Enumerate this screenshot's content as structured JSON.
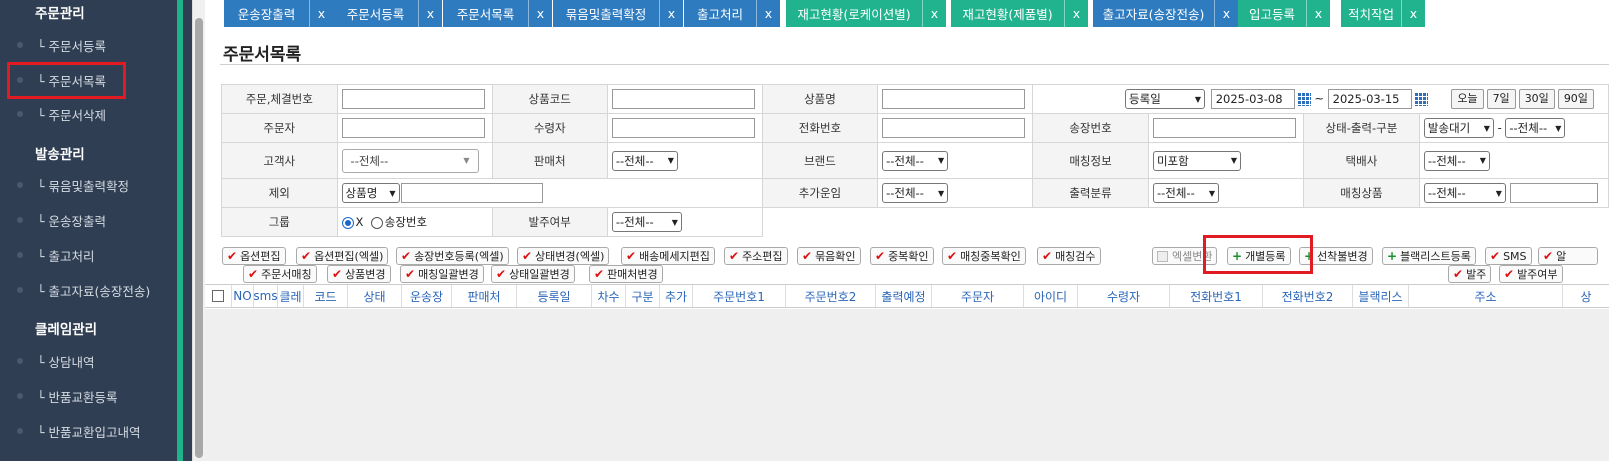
{
  "sidebar": {
    "sections": [
      {
        "title": "주문관리",
        "items": [
          "└ 주문서등록",
          "└ 주문서목록",
          "└ 주문서삭제"
        ]
      },
      {
        "title": "발송관리",
        "items": [
          "└ 묶음및출력확정",
          "└ 운송장출력",
          "└ 출고처리",
          "└ 출고자료(송장전송)"
        ]
      },
      {
        "title": "클레임관리",
        "items": [
          "└ 상담내역",
          "└ 반품교환등록",
          "└ 반품교환입고내역"
        ]
      }
    ]
  },
  "tabs": [
    {
      "label": "운송장출력",
      "close": "x",
      "color": "blue"
    },
    {
      "label": "주문서등록",
      "close": "x",
      "color": "blue"
    },
    {
      "label": "주문서목록",
      "close": "x",
      "color": "blue"
    },
    {
      "label": "묶음및출력확정",
      "close": "x",
      "color": "blue"
    },
    {
      "label": "출고처리",
      "close": "x",
      "color": "blue"
    },
    {
      "label": "재고현황(로케이션별)",
      "close": "x",
      "color": "green"
    },
    {
      "label": "재고현황(제품별)",
      "close": "x",
      "color": "green"
    },
    {
      "label": "출고자료(송장전송)",
      "close": "x",
      "color": "blue"
    },
    {
      "label": "입고등록",
      "close": "x",
      "color": "green"
    },
    {
      "label": "적치작업",
      "close": "x",
      "color": "green"
    }
  ],
  "page": {
    "title": "주문서목록"
  },
  "search": {
    "row1": {
      "order_no": "주문,체결번호",
      "product_code": "상품코드",
      "product_name": "상품명",
      "date_type": "등록일",
      "date_from": "2025-03-08",
      "tilde": "~",
      "date_to": "2025-03-15",
      "quick": [
        "오늘",
        "7일",
        "30일",
        "90일"
      ]
    },
    "row2": {
      "orderer": "주문자",
      "receiver": "수령자",
      "phone": "전화번호",
      "invoice": "송장번호",
      "status_label": "상태-출력-구분",
      "status_val": "발송대기",
      "dash": "-",
      "status_val2": "--전체--"
    },
    "row3": {
      "customer": "고객사",
      "customer_val": "--전체--",
      "seller": "판매처",
      "seller_val": "--전체--",
      "brand": "브랜드",
      "brand_val": "--전체--",
      "match_info": "매칭정보",
      "match_val": "미포함",
      "courier": "택배사",
      "courier_val": "--전체--"
    },
    "row4": {
      "exclude": "제외",
      "exclude_val": "상품명",
      "extra_fare": "추가운임",
      "extra_val": "--전체--",
      "print_class": "출력분류",
      "print_val": "--전체--",
      "match_product": "매칭상품",
      "match_prod_val": "--전체--"
    },
    "row5": {
      "group": "그룹",
      "opt_x": "X",
      "opt_invoice": "송장번호",
      "order_status": "발주여부",
      "order_status_val": "--전체--"
    }
  },
  "actions": {
    "row1": [
      "옵션편집",
      "옵션편집(엑셀)",
      "송장번호등록(엑셀)",
      "상태변경(엑셀)",
      "배송메세지편집",
      "주소편집",
      "묶음확인",
      "중복확인",
      "매칭중복확인",
      "매칭검수"
    ],
    "excel_convert": "엑셀변환",
    "individual_reg": "개별등록",
    "prepaid_change": "선착불변경",
    "blacklist_reg": "블랙리스트등록",
    "sms": "SMS",
    "alarm": "알",
    "row2": [
      "주문서매칭",
      "상품변경",
      "매칭일괄변경",
      "상태일괄변경",
      "판매처변경"
    ],
    "order": "발주",
    "order_cancel": "발주여부"
  },
  "table": {
    "columns": [
      "NO",
      "sms",
      "클레",
      "코드",
      "상태",
      "운송장",
      "판매처",
      "등록일",
      "차수",
      "구분",
      "추가",
      "주문번호1",
      "주문번호2",
      "출력예정",
      "주문자",
      "아이디",
      "수령자",
      "전화번호1",
      "전화번호2",
      "블랙리스",
      "주소",
      "상"
    ]
  }
}
